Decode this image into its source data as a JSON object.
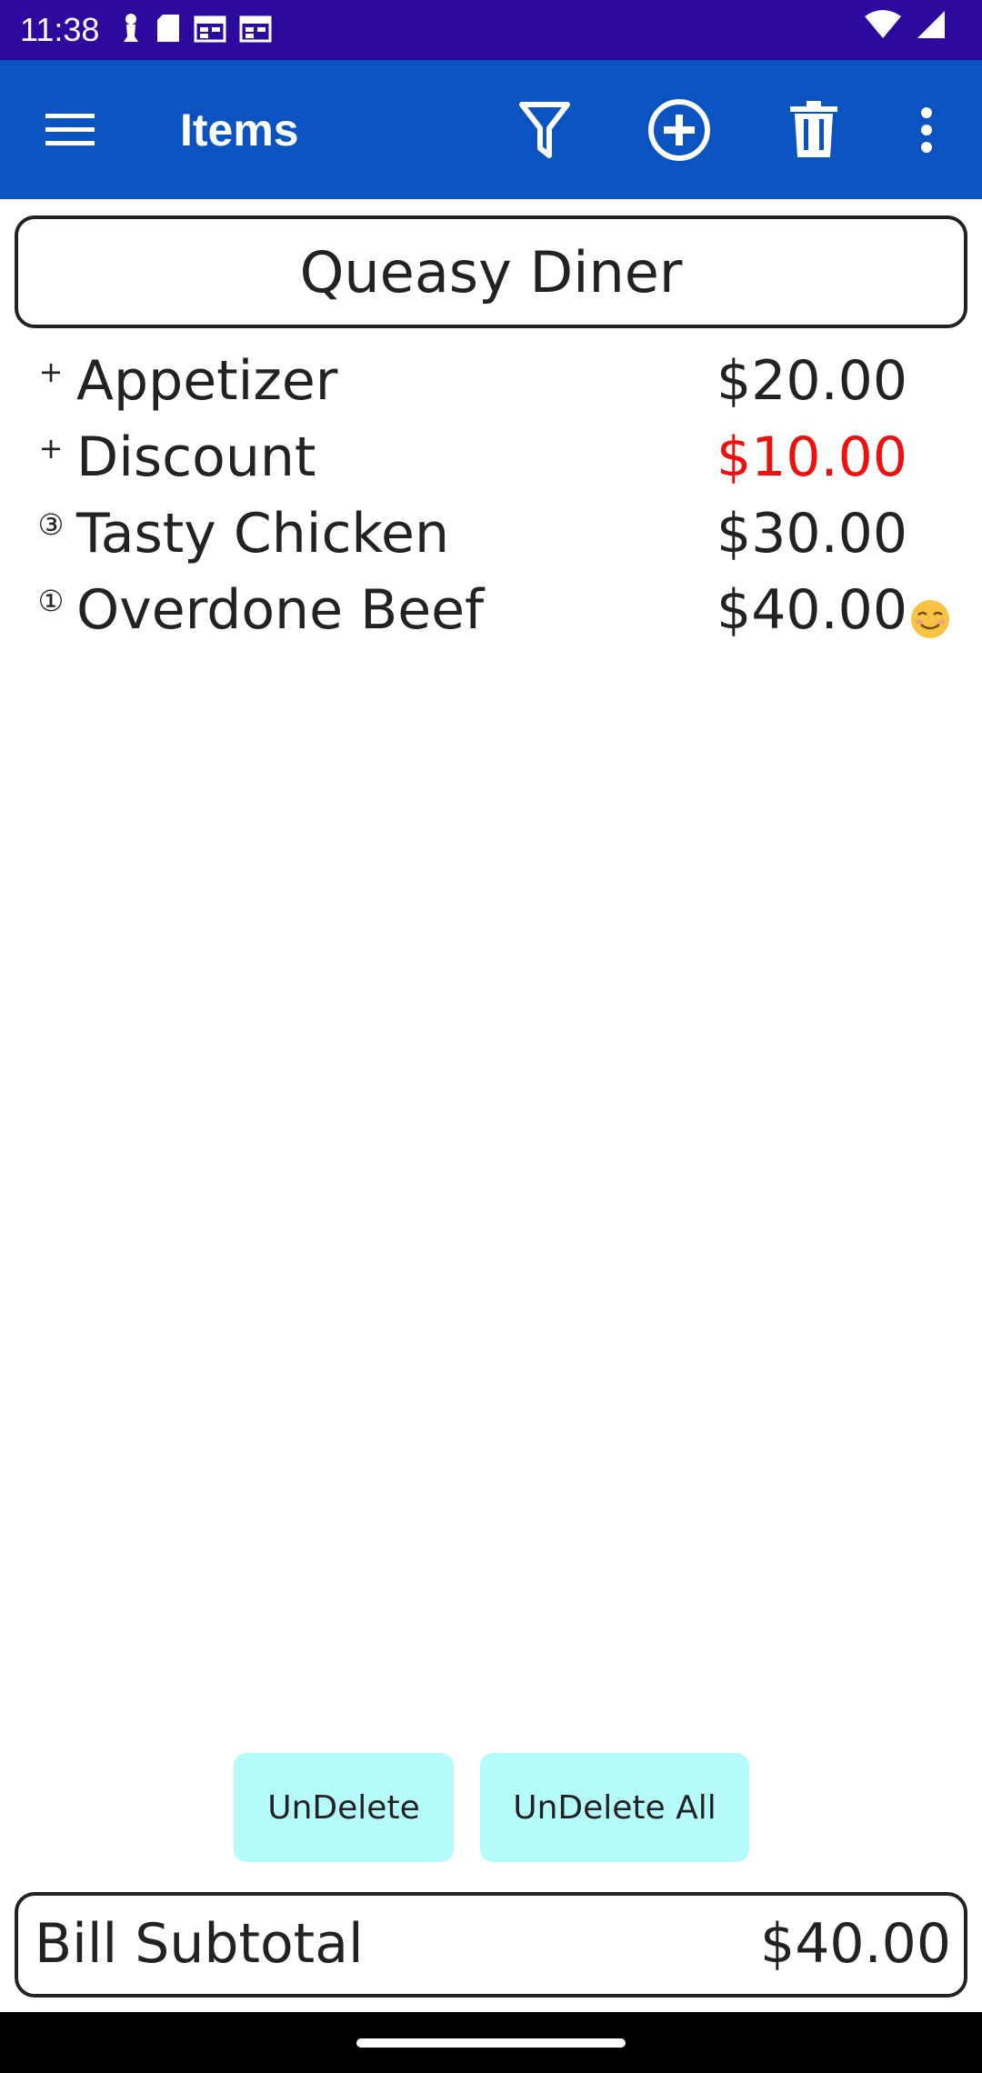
{
  "status_bar": {
    "time": "11:38",
    "icons": [
      "chess-pawn-icon",
      "sd-card-icon",
      "calendar-icon",
      "calendar-icon",
      "wifi-icon",
      "signal-icon"
    ]
  },
  "app_bar": {
    "title": "Items",
    "actions": [
      "menu-icon",
      "filter-icon",
      "add-circle-icon",
      "delete-icon",
      "more-vert-icon"
    ],
    "color": "#0a53c0"
  },
  "restaurant": {
    "name": "Queasy Diner"
  },
  "items": [
    {
      "marker": "+",
      "name": "Appetizer",
      "price": "$20.00",
      "negative": false
    },
    {
      "marker": "+",
      "name": "Discount",
      "price": "$10.00",
      "negative": true
    },
    {
      "marker": "③",
      "name": "Tasty Chicken",
      "price": "$30.00",
      "negative": false
    },
    {
      "marker": "①",
      "name": "Overdone Beef",
      "price": "$40.00",
      "negative": false,
      "emoji": "smiling-face-icon"
    }
  ],
  "buttons": {
    "undelete": "UnDelete",
    "undelete_all": "UnDelete All"
  },
  "subtotal": {
    "label": "Bill Subtotal",
    "value": "$40.00"
  },
  "colors": {
    "status_bar": "#2b0a9d",
    "negative_price": "#ee0f0f",
    "button_bg": "#b6fbfb"
  }
}
